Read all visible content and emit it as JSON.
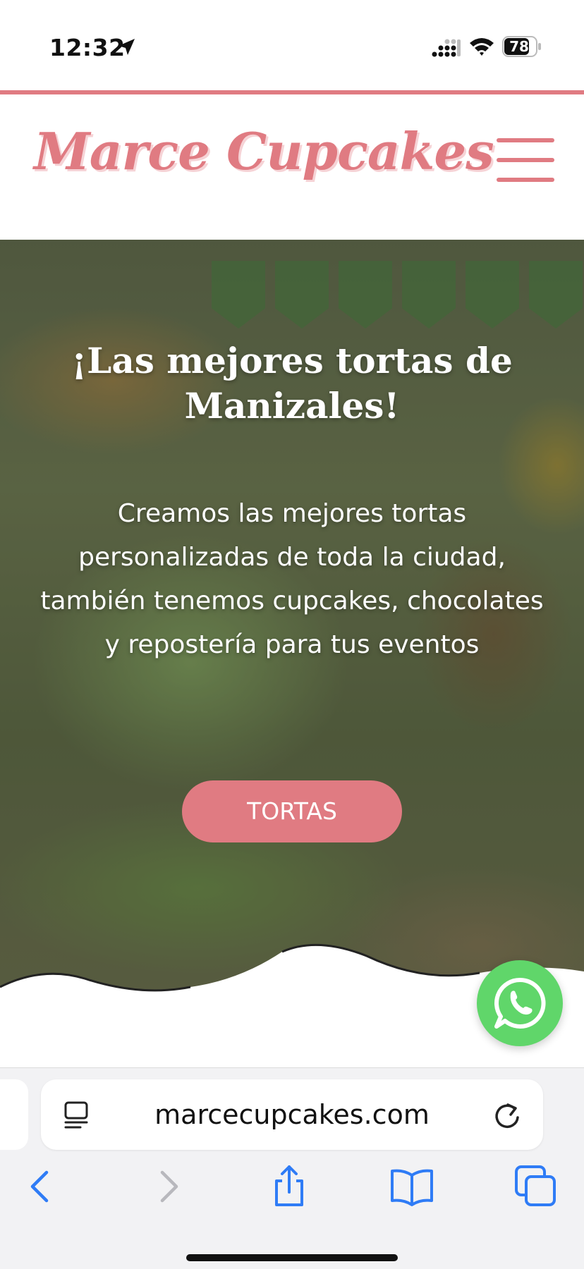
{
  "status_bar": {
    "time": "12:32",
    "battery": "78",
    "icons": [
      "location-arrow-icon",
      "cellular-signal-icon",
      "wifi-icon",
      "battery-icon"
    ]
  },
  "header": {
    "logo": "Marce Cupcakes",
    "menu_icon": "hamburger-menu-icon"
  },
  "hero": {
    "title": "¡Las mejores tortas de Manizales!",
    "description": "Creamos las mejores tortas personalizadas de toda la ciudad, también tenemos cupcakes, chocolates y repostería para tus eventos",
    "button_label": "TORTAS"
  },
  "floating": {
    "whatsapp_icon": "whatsapp-icon"
  },
  "browser": {
    "url": "marcecupcakes.com",
    "toolbar_icons": [
      "back-icon",
      "forward-icon",
      "share-icon",
      "bookmarks-icon",
      "tabs-icon"
    ]
  },
  "colors": {
    "brand_pink": "#e07b82",
    "whatsapp_green": "#60d66a",
    "safari_blue": "#2f7cf6"
  }
}
